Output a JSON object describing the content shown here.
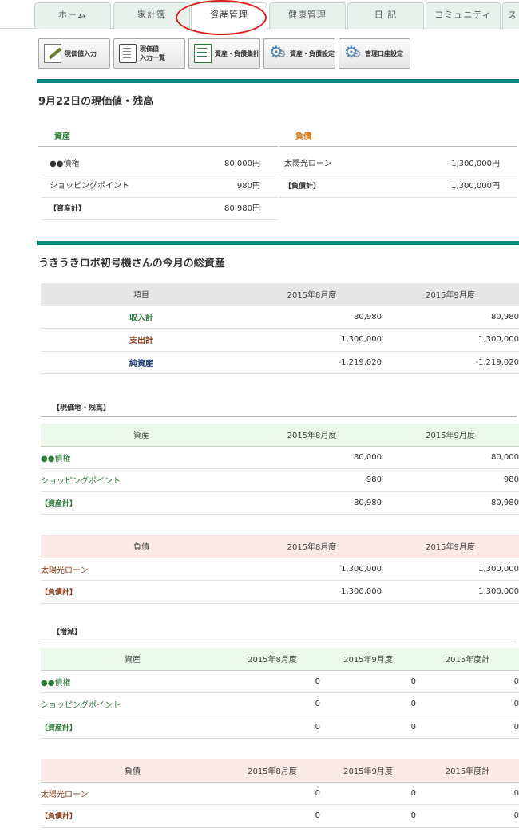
{
  "tabs": [
    "ホーム",
    "家計簿",
    "資産管理",
    "健康管理",
    "日 記",
    "コミュニティ",
    "ス"
  ],
  "active_tab": "資産管理",
  "toolbar": [
    {
      "label1": "現価値入力",
      "label2": "",
      "icon": "pen-icon"
    },
    {
      "label1": "現価値",
      "label2": "入力一覧",
      "icon": "document-icon"
    },
    {
      "label1": "資産・負債集計",
      "label2": "",
      "icon": "sheet-icon"
    },
    {
      "label1": "資産・負債設定",
      "label2": "",
      "icon": "gear-icon"
    },
    {
      "label1": "管理口座設定",
      "label2": "",
      "icon": "gear-icon"
    }
  ],
  "current": {
    "title": "9月22日の現価値・残高",
    "assets_label": "資産",
    "liabilities_label": "負債",
    "assets": [
      {
        "name": "●●債権",
        "value": "80,000円"
      },
      {
        "name": "ショッピングポイント",
        "value": "980円"
      },
      {
        "name": "【資産計】",
        "value": "80,980円"
      }
    ],
    "liabilities": [
      {
        "name": "太陽光ローン",
        "value": "1,300,000円"
      },
      {
        "name": "【負債計】",
        "value": "1,300,000円"
      }
    ]
  },
  "monthly": {
    "title": "うきうきロボ初号機さんの今月の総資産",
    "summary": {
      "header": [
        "項目",
        "2015年8月度",
        "2015年9月度"
      ],
      "rows": [
        [
          "収入計",
          "80,980",
          "80,980"
        ],
        [
          "支出計",
          "1,300,000",
          "1,300,000"
        ],
        [
          "純資産",
          "-1,219,020",
          "-1,219,020"
        ]
      ]
    },
    "balance_label": "【現価地・残高】",
    "balance_assets": {
      "header": [
        "資産",
        "2015年8月度",
        "2015年9月度"
      ],
      "rows": [
        [
          "●●債権",
          "80,000",
          "80,000"
        ],
        [
          "ショッピングポイント",
          "980",
          "980"
        ],
        [
          "【資産計】",
          "80,980",
          "80,980"
        ]
      ]
    },
    "balance_liabilities": {
      "header": [
        "負債",
        "2015年8月度",
        "2015年9月度"
      ],
      "rows": [
        [
          "太陽光ローン",
          "1,300,000",
          "1,300,000"
        ],
        [
          "【負債計】",
          "1,300,000",
          "1,300,000"
        ]
      ]
    },
    "change_label": "【増減】",
    "change_assets": {
      "header": [
        "資産",
        "2015年8月度",
        "2015年9月度",
        "2015年度計"
      ],
      "rows": [
        [
          "●●債権",
          "0",
          "0",
          "0"
        ],
        [
          "ショッピングポイント",
          "0",
          "0",
          "0"
        ],
        [
          "【資産計】",
          "0",
          "0",
          "0"
        ]
      ]
    },
    "change_liabilities": {
      "header": [
        "負債",
        "2015年8月度",
        "2015年9月度",
        "2015年度計"
      ],
      "rows": [
        [
          "太陽光ローン",
          "0",
          "0",
          "0"
        ],
        [
          "【負債計】",
          "0",
          "0",
          "0"
        ]
      ]
    }
  }
}
